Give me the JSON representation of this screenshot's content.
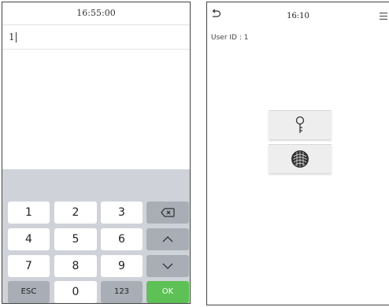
{
  "left_screen": {
    "status_time": "16:55:00",
    "input_value": "1",
    "keypad": {
      "rows": [
        [
          "1",
          "2",
          "3"
        ],
        [
          "4",
          "5",
          "6"
        ],
        [
          "7",
          "8",
          "9"
        ]
      ],
      "esc_label": "ESC",
      "zero_label": "0",
      "mode_label": "123",
      "ok_label": "OK",
      "backspace_icon": "backspace-icon",
      "up_icon": "chevron-up-icon",
      "down_icon": "chevron-down-icon"
    }
  },
  "right_screen": {
    "back_icon": "back-arrow-icon",
    "time": "16:10",
    "menu_icon": "menu-icon",
    "user_id_text": "User ID : 1",
    "verification_buttons": [
      {
        "icon": "key-icon"
      },
      {
        "icon": "fingerprint-icon"
      }
    ]
  },
  "colors": {
    "keypad_background": "#cfd3d9",
    "function_key": "#a8adb6",
    "ok_key": "#5ec155"
  }
}
